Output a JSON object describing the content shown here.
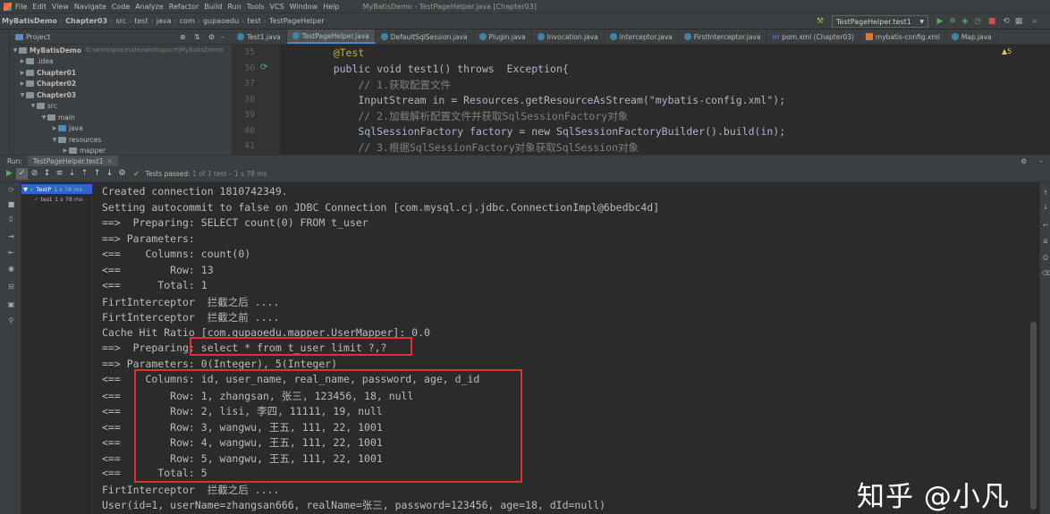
{
  "menubar": {
    "items": [
      "File",
      "Edit",
      "View",
      "Navigate",
      "Code",
      "Analyze",
      "Refactor",
      "Build",
      "Run",
      "Tools",
      "VCS",
      "Window",
      "Help"
    ],
    "window_title": "MyBatisDemo - TestPageHelper.java [Chapter03]"
  },
  "breadcrumbs": [
    "MyBatisDemo",
    "Chapter03",
    "src",
    "test",
    "java",
    "com",
    "gupaoedu",
    "test",
    "TestPageHelper"
  ],
  "run_config": "TestPageHelper.test1",
  "project": {
    "header": "Project",
    "rows": [
      {
        "label": "MyBatisDemo",
        "path": "D:\\workspace\\ideaworkspace\\MyBatisDemo"
      },
      {
        "label": ".idea"
      },
      {
        "label": "Chapter01"
      },
      {
        "label": "Chapter02"
      },
      {
        "label": "Chapter03"
      },
      {
        "label": "src"
      },
      {
        "label": "main"
      },
      {
        "label": "java"
      },
      {
        "label": "resources"
      },
      {
        "label": "mapper"
      }
    ]
  },
  "editor_tabs": [
    {
      "label": "Test1.java",
      "icon": "class"
    },
    {
      "label": "TestPageHelper.java",
      "icon": "class",
      "active": true
    },
    {
      "label": "DefaultSqlSession.java",
      "icon": "class"
    },
    {
      "label": "Plugin.java",
      "icon": "class"
    },
    {
      "label": "Invocation.java",
      "icon": "class"
    },
    {
      "label": "Interceptor.java",
      "icon": "class"
    },
    {
      "label": "FirstInterceptor.java",
      "icon": "class"
    },
    {
      "label": "pom.xml (Chapter03)",
      "icon": "maven"
    },
    {
      "label": "mybatis-config.xml",
      "icon": "xml"
    },
    {
      "label": "Map.java",
      "icon": "class"
    }
  ],
  "editor": {
    "warnings": "5",
    "lines": [
      {
        "n": "35",
        "text": "    @Test"
      },
      {
        "n": "36",
        "text": "    public void test1() throws  Exception{"
      },
      {
        "n": "37",
        "text": "        // 1.获取配置文件"
      },
      {
        "n": "38",
        "text": "        InputStream in = Resources.getResourceAsStream(\"mybatis-config.xml\");"
      },
      {
        "n": "39",
        "text": "        // 2.加载解析配置文件并获取SqlSessionFactory对象"
      },
      {
        "n": "40",
        "text": "        SqlSessionFactory factory = new SqlSessionFactoryBuilder().build(in);"
      },
      {
        "n": "41",
        "text": "        // 3.根据SqlSessionFactory对象获取SqlSession对象"
      }
    ]
  },
  "run_panel": {
    "label": "Run:",
    "tab": "TestPageHelper.test1",
    "status_prefix": "Tests passed:",
    "status_detail": "1 of 1 test – 1 s 78 ms",
    "tree": [
      {
        "label": "TestP",
        "time": "1 s 78 ms"
      },
      {
        "label": "test",
        "time": "1 s 78 ms"
      }
    ]
  },
  "console": {
    "lines": [
      "Created connection 1810742349.",
      "Setting autocommit to false on JDBC Connection [com.mysql.cj.jdbc.ConnectionImpl@6bedbc4d]",
      "==>  Preparing: SELECT count(0) FROM t_user",
      "==> Parameters: ",
      "<==    Columns: count(0)",
      "<==        Row: 13",
      "<==      Total: 1",
      "FirtInterceptor  拦截之后 ....",
      "FirtInterceptor  拦截之前 ....",
      "Cache Hit Ratio [com.gupaoedu.mapper.UserMapper]: 0.0",
      "==>  Preparing: select * from t_user limit ?,?",
      "==> Parameters: 0(Integer), 5(Integer)",
      "<==    Columns: id, user_name, real_name, password, age, d_id",
      "<==        Row: 1, zhangsan, 张三, 123456, 18, null",
      "<==        Row: 2, lisi, 李四, 11111, 19, null",
      "<==        Row: 3, wangwu, 王五, 111, 22, 1001",
      "<==        Row: 4, wangwu, 王五, 111, 22, 1001",
      "<==        Row: 5, wangwu, 王五, 111, 22, 1001",
      "<==      Total: 5",
      "FirtInterceptor  拦截之后 ....",
      "User(id=1, userName=zhangsan666, realName=张三, password=123456, age=18, dId=null)"
    ]
  },
  "watermark": "知乎 @小凡",
  "colors": {
    "highlight": "#e23030",
    "keyword": "#cc7832",
    "string": "#6a8759",
    "comment": "#808080"
  }
}
